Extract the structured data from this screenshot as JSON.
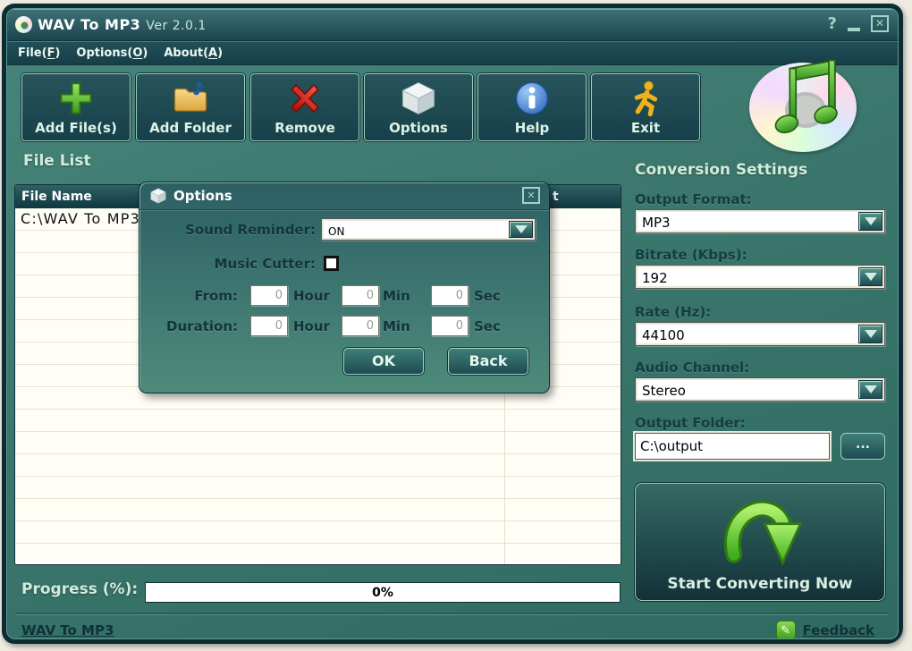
{
  "window": {
    "title": "WAV To MP3",
    "version": "Ver 2.0.1",
    "help_glyph": "?",
    "close_glyph": "✕"
  },
  "menu": {
    "items": [
      {
        "pre": "File(",
        "key": "F",
        "post": ")"
      },
      {
        "pre": "Options(",
        "key": "O",
        "post": ")"
      },
      {
        "pre": "About(",
        "key": "A",
        "post": ")"
      }
    ]
  },
  "toolbar": {
    "buttons": [
      {
        "label": "Add File(s)",
        "icon": "add-files-plus-icon"
      },
      {
        "label": "Add Folder",
        "icon": "add-folder-icon"
      },
      {
        "label": "Remove",
        "icon": "remove-x-icon"
      },
      {
        "label": "Options",
        "icon": "options-cube-icon"
      },
      {
        "label": "Help",
        "icon": "help-info-icon"
      },
      {
        "label": "Exit",
        "icon": "exit-runner-icon"
      }
    ]
  },
  "file_list": {
    "section_title": "File List",
    "columns": [
      "File Name",
      "t"
    ],
    "rows": [
      "C:\\WAV To MP3"
    ]
  },
  "dialog": {
    "title": "Options",
    "close_glyph": "✕",
    "sound_reminder_label": "Sound Reminder:",
    "sound_reminder_value": "ON",
    "music_cutter_label": "Music Cutter:",
    "music_cutter_checked": false,
    "time_rows": [
      {
        "label": "From:",
        "fields": [
          {
            "value": "0",
            "unit": "Hour"
          },
          {
            "value": "0",
            "unit": "Min"
          },
          {
            "value": "0",
            "unit": "Sec"
          }
        ]
      },
      {
        "label": "Duration:",
        "fields": [
          {
            "value": "0",
            "unit": "Hour"
          },
          {
            "value": "0",
            "unit": "Min"
          },
          {
            "value": "0",
            "unit": "Sec"
          }
        ]
      }
    ],
    "ok_label": "OK",
    "back_label": "Back"
  },
  "settings": {
    "section_title": "Conversion Settings",
    "output_format_label": "Output Format:",
    "output_format_value": "MP3",
    "bitrate_label": "Bitrate (Kbps):",
    "bitrate_value": "192",
    "rate_label": "Rate (Hz):",
    "rate_value": "44100",
    "audio_channel_label": "Audio Channel:",
    "audio_channel_value": "Stereo",
    "output_folder_label": "Output Folder:",
    "output_folder_value": "C:\\output",
    "browse_label": "...",
    "start_button_label": "Start Converting Now"
  },
  "progress": {
    "label": "Progress (%):",
    "value_text": "0%",
    "percent": 0
  },
  "status_bar": {
    "left_link": "WAV To MP3",
    "right_link": "Feedback"
  },
  "colors": {
    "accent_green": "#3f9e1c",
    "teal_dark": "#16404a",
    "teal_mid": "#3b776d",
    "mint_text": "#d2ecdc",
    "list_bg": "#fffef6"
  }
}
